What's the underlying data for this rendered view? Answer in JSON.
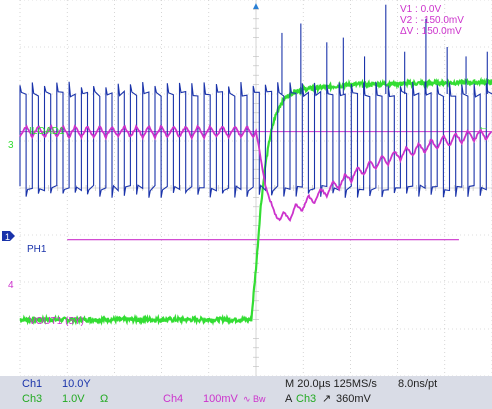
{
  "chart_data": {
    "type": "line",
    "time_axis": {
      "divisions": 10,
      "unit": "µs",
      "time_per_div": 20
    },
    "vertical_divisions": 8,
    "grid": true,
    "cursor_readout": {
      "v1": "V1 :   0.0V",
      "v2": "V2 :  -150.0mV",
      "dv": "ΔV :   150.0mV"
    },
    "series": [
      {
        "name": "ILOAD1",
        "channel": "3",
        "color": "#33dd33",
        "x": [
          0,
          98,
          100,
          102,
          104,
          106,
          108,
          110,
          112,
          114,
          116,
          120,
          130,
          140,
          160,
          180,
          200
        ],
        "y_div": [
          1.2,
          1.2,
          2.3,
          3.6,
          4.5,
          5.1,
          5.5,
          5.75,
          5.9,
          5.98,
          6.05,
          6.1,
          6.15,
          6.2,
          6.22,
          6.24,
          6.25
        ]
      },
      {
        "name": "PH1",
        "channel": "1",
        "color": "#1a33aa",
        "switching": {
          "high_div": 6.0,
          "low_div": 4.0,
          "period_us": 5.2,
          "duty_before": 0.5
        },
        "spike_peaks_after_step": [
          {
            "x": 111,
            "y_div": 7.3
          },
          {
            "x": 119,
            "y_div": 7.5
          },
          {
            "x": 130,
            "y_div": 7.1
          },
          {
            "x": 137,
            "y_div": 7.2
          },
          {
            "x": 146,
            "y_div": 6.8
          },
          {
            "x": 155,
            "y_div": 7.9
          },
          {
            "x": 163,
            "y_div": 6.9
          },
          {
            "x": 172,
            "y_div": 7.6
          },
          {
            "x": 181,
            "y_div": 7.0
          },
          {
            "x": 189,
            "y_div": 6.8
          },
          {
            "x": 198,
            "y_div": 6.9
          }
        ]
      },
      {
        "name": "VOUT1 (5Y)",
        "channel": "4",
        "color": "#cc33cc",
        "ripple": {
          "baseline_div": 5.2,
          "amplitude_div": 0.12,
          "period_us": 5.2
        },
        "x": [
          0,
          100,
          102,
          104,
          106,
          108,
          110,
          113,
          116,
          120,
          130,
          140,
          150,
          160,
          170,
          180,
          190,
          200
        ],
        "y_div": [
          5.2,
          5.2,
          4.6,
          4.1,
          3.7,
          3.45,
          3.35,
          3.4,
          3.5,
          3.65,
          3.95,
          4.25,
          4.5,
          4.7,
          4.85,
          5.0,
          5.1,
          5.15
        ],
        "reference_y_div": 2.9
      }
    ]
  },
  "markers": {
    "trigger": "▲",
    "ch3_marker": "3",
    "ch1_marker": "1",
    "ch4_marker": "4",
    "left_arrow": "→",
    "right_arrow": "←"
  },
  "status": {
    "ch1_label": "Ch1",
    "ch1_value": "10.0Y",
    "ch3_label": "Ch3",
    "ch3_value": "1.0V",
    "ch3_unit": "Ω",
    "ch4_label": "Ch4",
    "ch4_value": "100mV",
    "bw_icon": "∿ Bw",
    "timebase": "M 20.0µs 125MS/s",
    "sample_rate": "8.0ns/pt",
    "trigger_mode": "A",
    "trigger_channel": "Ch3",
    "trigger_slope": "↗",
    "trigger_level": "360mV"
  },
  "colors": {
    "background": "#ffffff",
    "grid": "#bbbbbb",
    "iload": "#33dd33",
    "ph": "#1a33aa",
    "vout": "#cc33cc",
    "status_bar": "#d9dce6",
    "ch1_text": "#1a33aa",
    "ch3_text": "#22aa22",
    "ch4_text": "#cc33cc"
  }
}
